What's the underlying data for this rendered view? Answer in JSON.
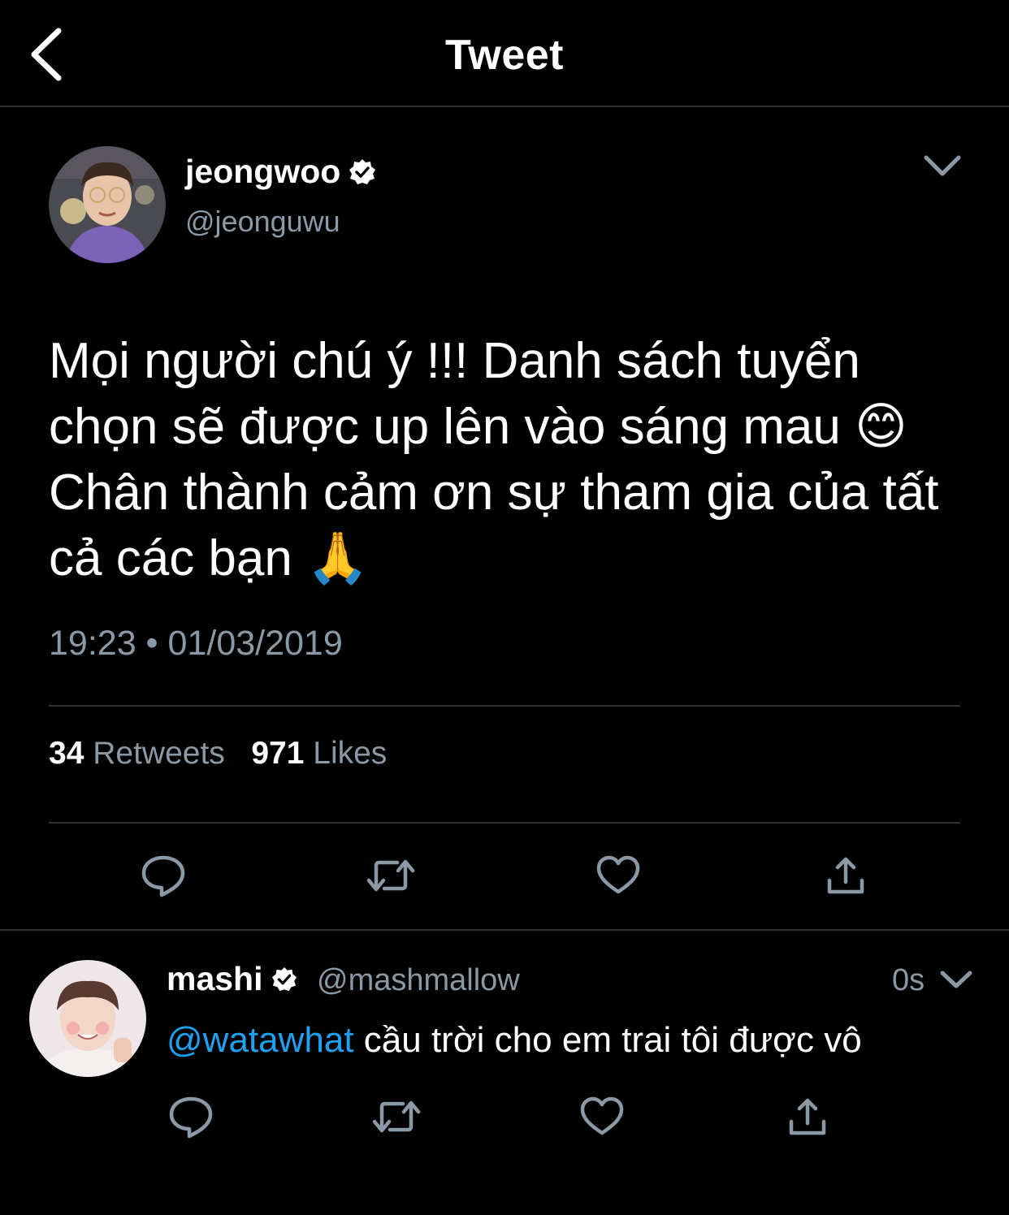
{
  "header": {
    "title": "Tweet",
    "back_icon": "chevron-left-icon"
  },
  "tweet": {
    "display_name": "jeongwoo",
    "verified": true,
    "handle": "@jeonguwu",
    "text_line1": "Mọi người chú ý !!! Danh sách tuyển",
    "text_line2": "chọn sẽ được up lên vào sáng mau",
    "emoji_smile": "😊",
    "text_line3": "Chân thành cảm ơn sự tham gia của tất",
    "text_line4": "cả các bạn",
    "emoji_pray": "🙏",
    "timestamp": "19:23 • 01/03/2019",
    "retweets_count": "34",
    "retweets_label": "Retweets",
    "likes_count": "971",
    "likes_label": "Likes"
  },
  "reply": {
    "display_name": "mashi",
    "verified": true,
    "handle": "@mashmallow",
    "time_ago": "0s",
    "mention": "@watawhat",
    "text": " cầu trời cho em trai tôi được vô"
  },
  "colors": {
    "background": "#000000",
    "text": "#ffffff",
    "secondary": "#8b98a5",
    "link": "#1da1f2",
    "divider": "#2f3336"
  },
  "icons": [
    "reply-icon",
    "retweet-icon",
    "like-icon",
    "share-icon",
    "chevron-down-icon",
    "verified-badge-icon"
  ]
}
